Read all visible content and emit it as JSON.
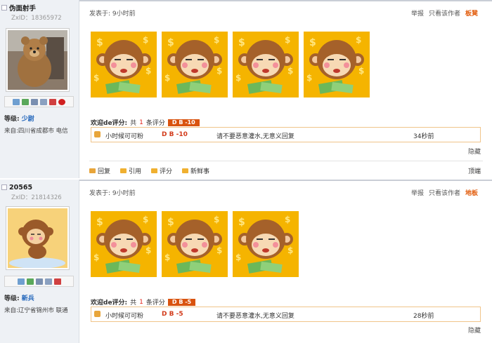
{
  "posts": [
    {
      "username": "伪面射手",
      "zxid": "ZxID：18365972",
      "level_label": "等级:",
      "level": "少尉",
      "from": "来自:四川省成都市 电信",
      "posted": "发表于: 9小时前",
      "actions": [
        "举报",
        "只看该作者"
      ],
      "floor": "板凳",
      "rating_title": "欢迎de评分:",
      "rating_count_prefix": "共",
      "rating_count": "1",
      "rating_count_suffix": "条评分",
      "rating_badge": "D B  -10",
      "rating": {
        "who": "小时候可可粉",
        "db": "D B -10",
        "reason": "请不要恶意灌水,无意义回复",
        "time": "34秒前"
      },
      "hide": "隐藏",
      "bottom": [
        "回复",
        "引用",
        "评分",
        "新鲜事"
      ],
      "bottom_right": "顶端",
      "image_count": 4
    },
    {
      "username": "20565",
      "zxid": "ZxID：21814326",
      "level_label": "等级:",
      "level": "新兵",
      "from": "来自:辽宁省锦州市 联通",
      "posted": "发表于: 9小时前",
      "actions": [
        "举报",
        "只看该作者"
      ],
      "floor": "地板",
      "rating_title": "欢迎de评分:",
      "rating_count_prefix": "共",
      "rating_count": "1",
      "rating_count_suffix": "条评分",
      "rating_badge": "D B  -5",
      "rating": {
        "who": "小时候可可粉",
        "db": "D B -5",
        "reason": "请不要恶意灌水,无意义回复",
        "time": "28秒前"
      },
      "hide": "隐藏",
      "image_count": 3
    }
  ],
  "colors": {
    "accent": "#e25c0c",
    "badge": "#d9530f",
    "link": "#2266bb"
  }
}
